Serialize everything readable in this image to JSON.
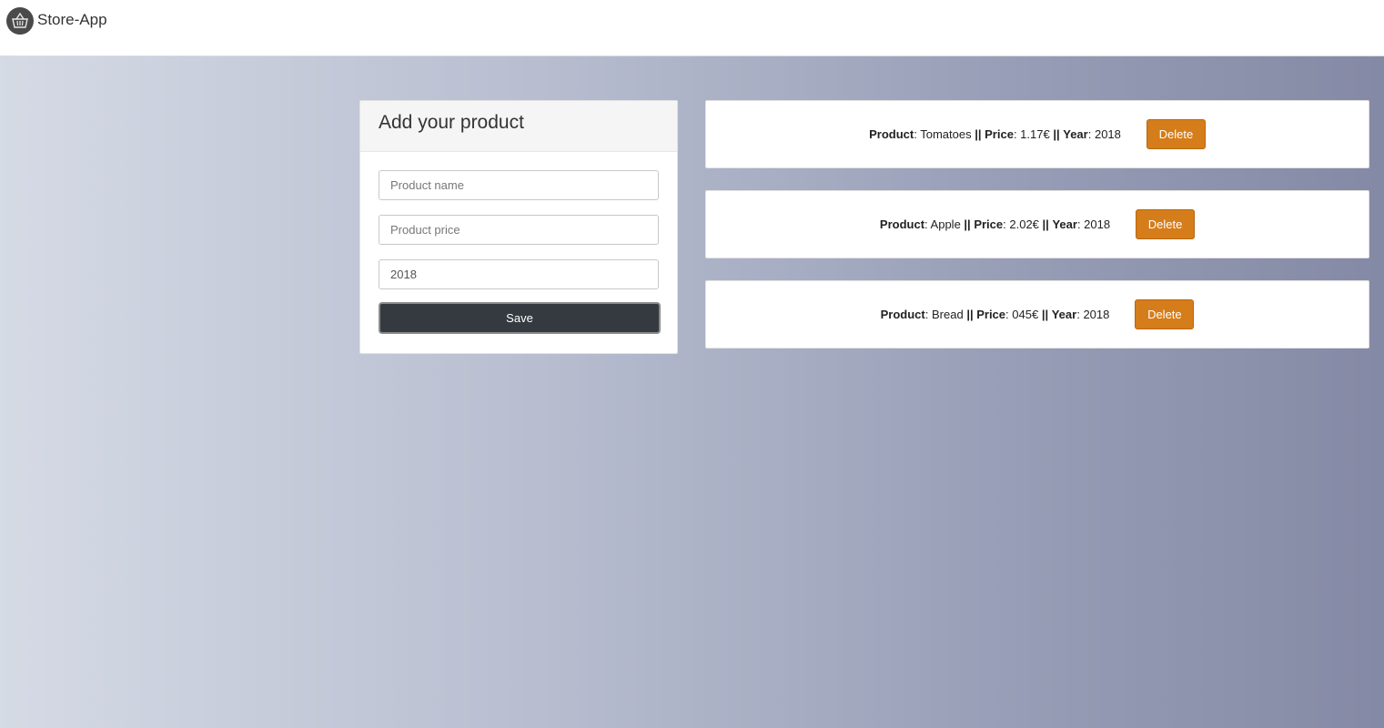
{
  "app": {
    "title": "Store-App",
    "logo_icon": "basket-icon"
  },
  "form": {
    "title": "Add your product",
    "name_placeholder": "Product name",
    "price_placeholder": "Product price",
    "year_value": "2018",
    "save_label": "Save"
  },
  "labels": {
    "product": "Product",
    "price": "Price",
    "year": "Year",
    "separator": "||"
  },
  "products": [
    {
      "name": "Tomatoes",
      "price": "1.17€",
      "year": "2018",
      "delete_label": "Delete"
    },
    {
      "name": "Apple",
      "price": "2.02€",
      "year": "2018",
      "delete_label": "Delete"
    },
    {
      "name": "Bread",
      "price": "045€",
      "year": "2018",
      "delete_label": "Delete"
    }
  ],
  "colors": {
    "delete": "#d57d1a",
    "save": "#343a40"
  }
}
